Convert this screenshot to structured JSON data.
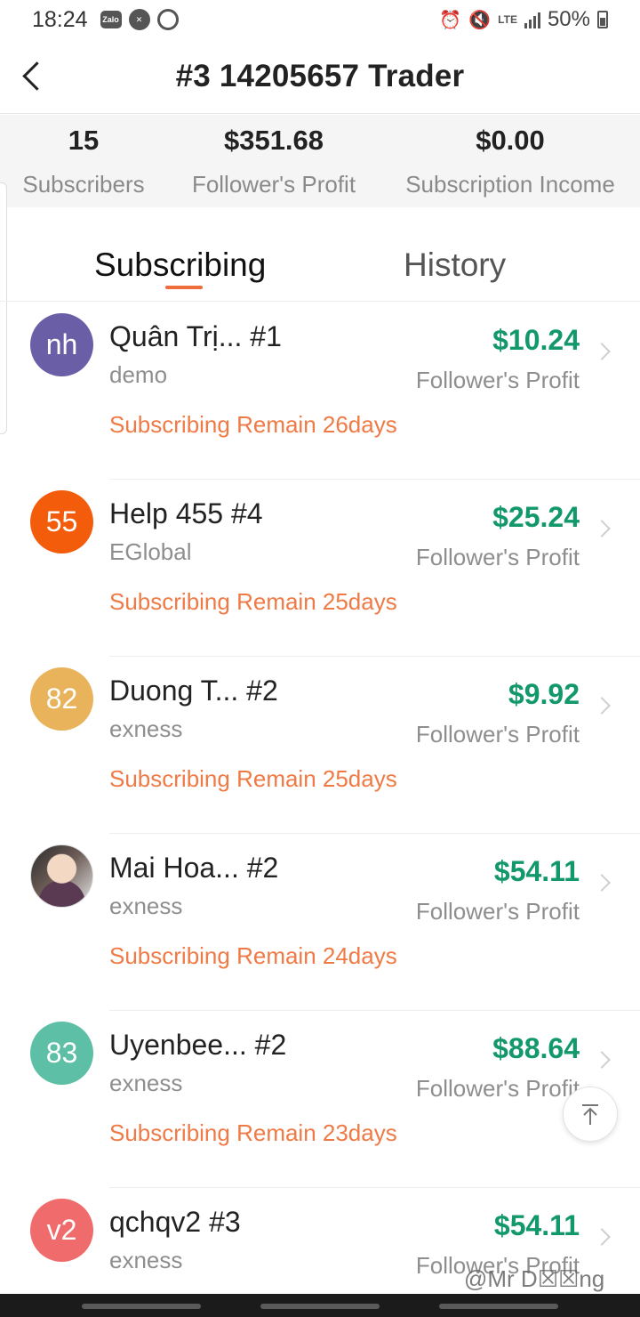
{
  "status_bar": {
    "time": "18:24",
    "left_icons": [
      "zalo-icon",
      "messenger-icon",
      "settings-ring-icon"
    ],
    "zalo_text": "Zalo",
    "lte": "LTE",
    "battery": "50%"
  },
  "header": {
    "title": "#3 14205657 Trader"
  },
  "stats": [
    {
      "value": "15",
      "label": "Subscribers"
    },
    {
      "value": "$351.68",
      "label": "Follower's Profit"
    },
    {
      "value": "$0.00",
      "label": "Subscription Income"
    }
  ],
  "tabs": [
    {
      "label": "Subscribing"
    },
    {
      "label": "History"
    }
  ],
  "subscribers": [
    {
      "avatar_text": "nh",
      "avatar_color": "#6a5fa6",
      "name": "Quân Trị...  #1",
      "broker": "demo",
      "profit": "$10.24",
      "profit_label": "Follower's Profit",
      "remain": "Subscribing Remain 26days"
    },
    {
      "avatar_text": "55",
      "avatar_color": "#f25c0a",
      "name": "Help 455 #4",
      "broker": "EGlobal",
      "profit": "$25.24",
      "profit_label": "Follower's Profit",
      "remain": "Subscribing Remain 25days"
    },
    {
      "avatar_text": "82",
      "avatar_color": "#e9b35c",
      "name": "Duong T...  #2",
      "broker": "exness",
      "profit": "$9.92",
      "profit_label": "Follower's Profit",
      "remain": "Subscribing Remain 25days"
    },
    {
      "avatar_text": "",
      "avatar_color": "",
      "name": "Mai Hoa...  #2",
      "broker": "exness",
      "profit": "$54.11",
      "profit_label": "Follower's Profit",
      "remain": "Subscribing Remain 24days"
    },
    {
      "avatar_text": "83",
      "avatar_color": "#5dbfa5",
      "name": "Uyenbee...  #2",
      "broker": "exness",
      "profit": "$88.64",
      "profit_label": "Follower's Profit",
      "remain": "Subscribing Remain 23days"
    },
    {
      "avatar_text": "v2",
      "avatar_color": "#f06b6b",
      "name": "qchqv2 #3",
      "broker": "exness",
      "profit": "$54.11",
      "profit_label": "Follower's Profit",
      "remain": ""
    }
  ],
  "watermark": "@Mr D☒☒ng",
  "colors": {
    "accent": "#ef6c3b",
    "profit_green": "#12986b",
    "remain_orange": "#ef7a45"
  }
}
